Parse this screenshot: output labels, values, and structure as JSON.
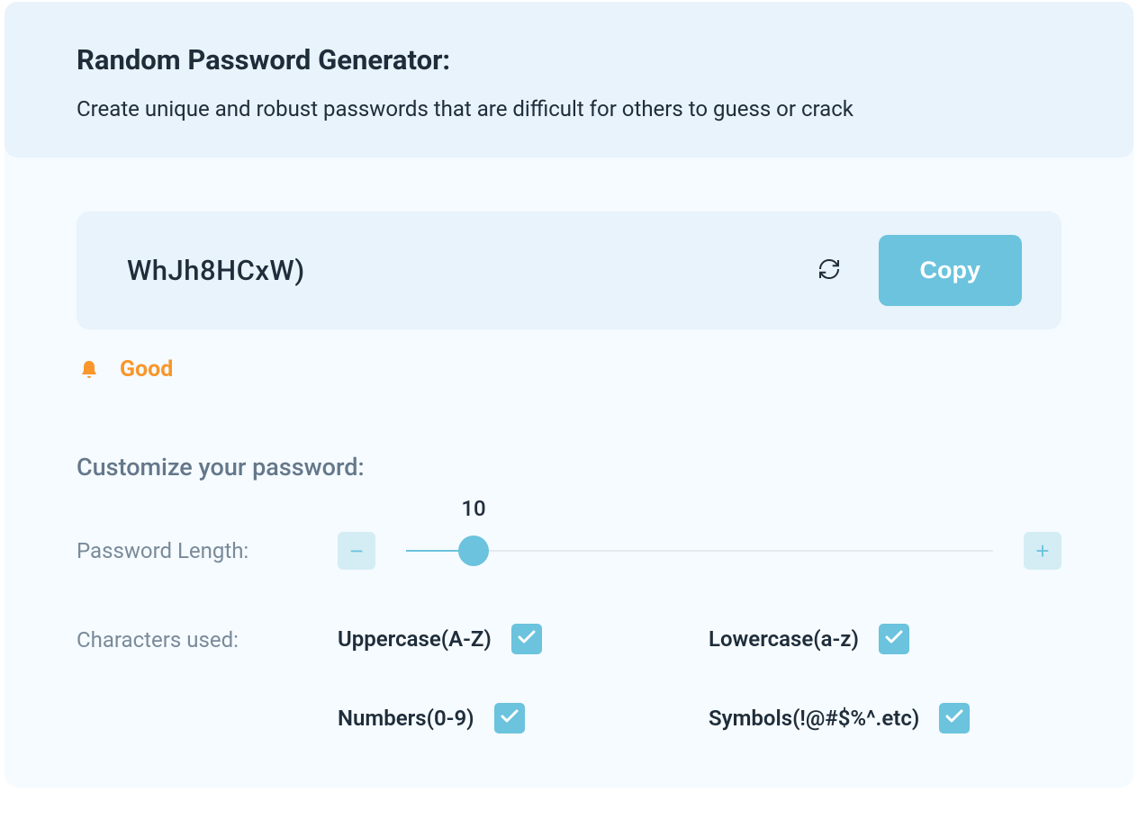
{
  "header": {
    "title": "Random Password Generator:",
    "subtitle": "Create unique and robust passwords that are difficult for others to guess or crack"
  },
  "password": {
    "value": "WhJh8HCxW)",
    "copy_label": "Copy"
  },
  "strength": {
    "label": "Good",
    "color": "#f9962c"
  },
  "customize": {
    "title": "Customize your password:",
    "length_label": "Password Length:",
    "length_value": "10",
    "chars_label": "Characters used:",
    "options": {
      "uppercase": {
        "label": "Uppercase(A-Z)",
        "checked": true
      },
      "lowercase": {
        "label": "Lowercase(a-z)",
        "checked": true
      },
      "numbers": {
        "label": "Numbers(0-9)",
        "checked": true
      },
      "symbols": {
        "label": "Symbols(!@#$%^.etc)",
        "checked": true
      }
    }
  }
}
